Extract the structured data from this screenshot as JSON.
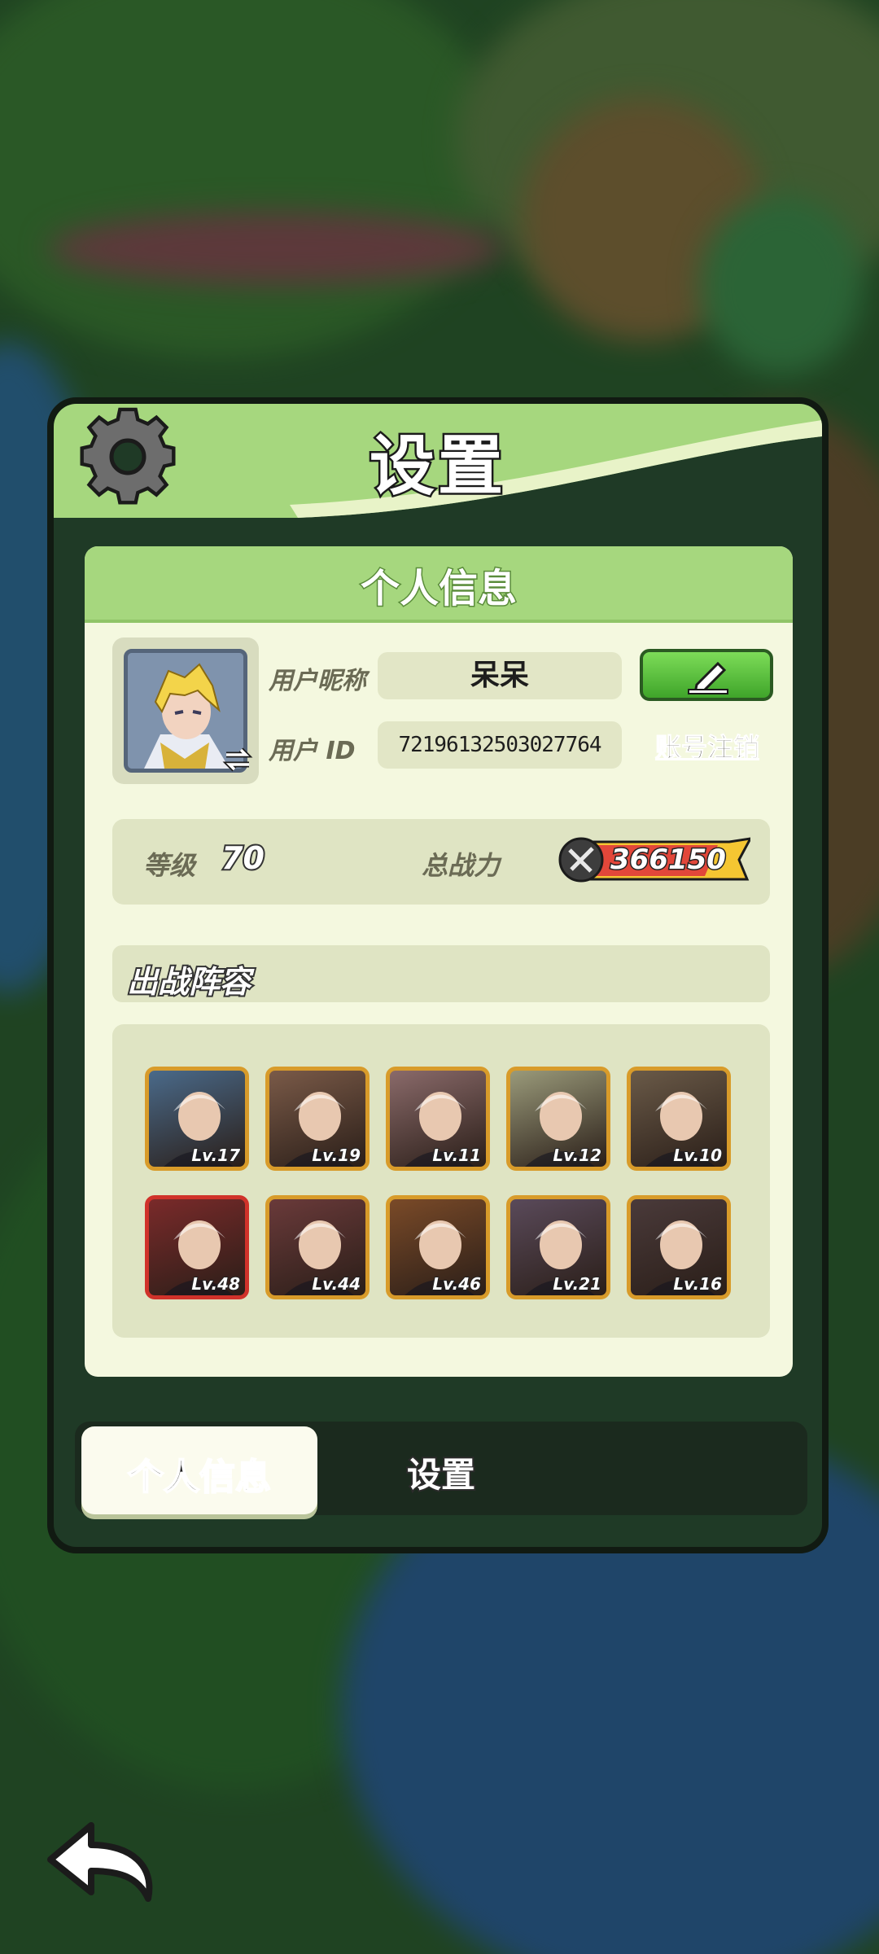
{
  "panel": {
    "title": "设置"
  },
  "info_section": {
    "header": "个人信息",
    "nickname_label": "用户昵称",
    "nickname_value": "呆呆",
    "id_label": "用户 ID",
    "id_value": "72196132503027764",
    "cancel_account_label": "账号注销",
    "level_label": "等级",
    "level_value": "70",
    "power_label": "总战力",
    "power_value": "366150"
  },
  "lineup": {
    "header": "出战阵容",
    "heroes": [
      {
        "level": "Lv.17",
        "frame": "gold"
      },
      {
        "level": "Lv.19",
        "frame": "gold"
      },
      {
        "level": "Lv.11",
        "frame": "gold"
      },
      {
        "level": "Lv.12",
        "frame": "gold"
      },
      {
        "level": "Lv.10",
        "frame": "gold"
      },
      {
        "level": "Lv.48",
        "frame": "red"
      },
      {
        "level": "Lv.44",
        "frame": "gold"
      },
      {
        "level": "Lv.46",
        "frame": "gold"
      },
      {
        "level": "Lv.21",
        "frame": "gold"
      },
      {
        "level": "Lv.16",
        "frame": "gold"
      }
    ]
  },
  "tabs": {
    "info_label": "个人信息",
    "settings_label": "设置",
    "active": "个人信息"
  },
  "colors": {
    "panel_green": "#a6d77e",
    "card_bg": "#f4f8df",
    "edit_button": "#4fb83a",
    "power_flame": "#f5c632"
  },
  "icons": {
    "settings": "gear-icon",
    "edit": "pencil-icon",
    "avatar_swap": "swap-icon",
    "power": "crossed-swords-icon",
    "back": "back-arrow-icon"
  }
}
